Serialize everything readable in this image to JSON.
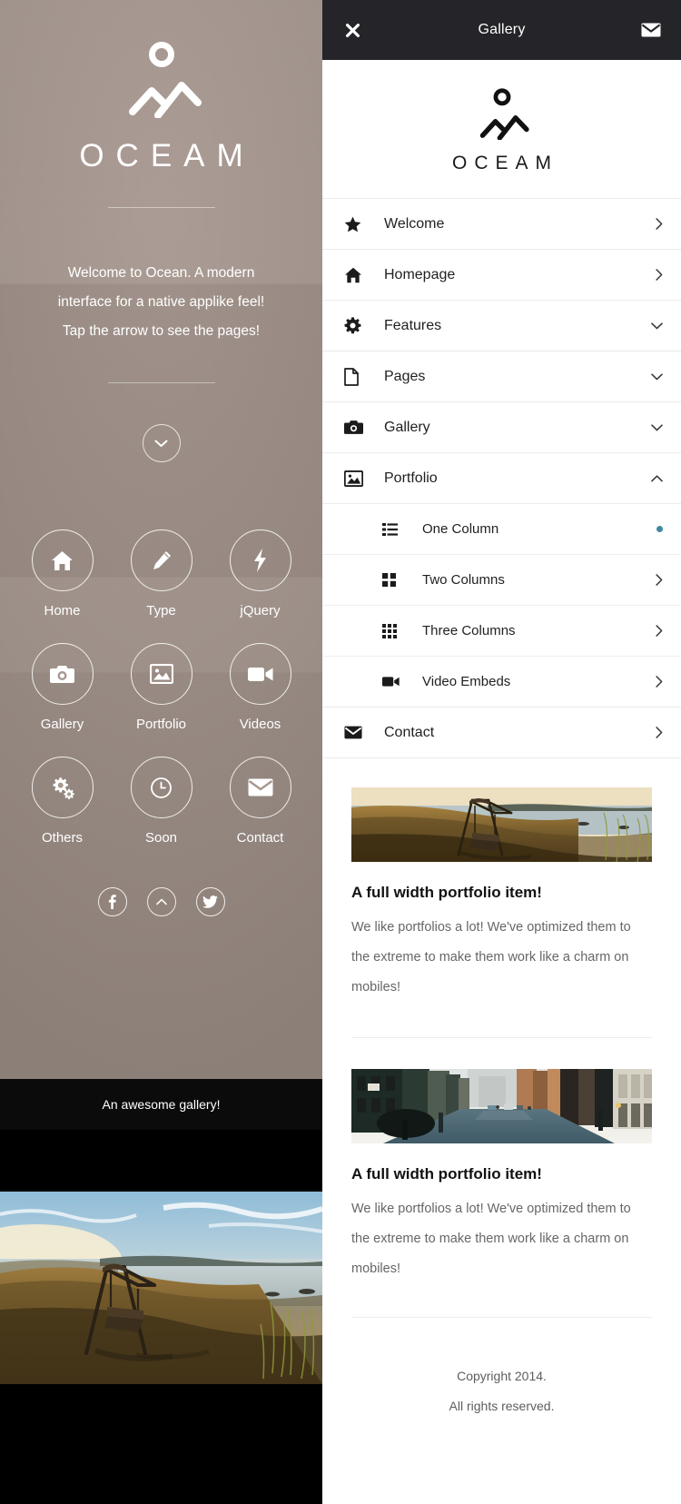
{
  "left": {
    "brand": "OCEAM",
    "logo_icon": "mountain-sun-logo",
    "hero_lines": [
      "Welcome to Ocean. A modern",
      "interface for a native applike feel!",
      "Tap the arrow to see the pages!"
    ],
    "scroll_icon": "chevron-down-icon",
    "grid": [
      {
        "label": "Home",
        "icon": "home-icon"
      },
      {
        "label": "Type",
        "icon": "pencil-icon"
      },
      {
        "label": "jQuery",
        "icon": "bolt-icon"
      },
      {
        "label": "Gallery",
        "icon": "camera-icon"
      },
      {
        "label": "Portfolio",
        "icon": "image-icon"
      },
      {
        "label": "Videos",
        "icon": "video-camera-icon"
      },
      {
        "label": "Others",
        "icon": "gears-icon"
      },
      {
        "label": "Soon",
        "icon": "clock-icon"
      },
      {
        "label": "Contact",
        "icon": "envelope-icon"
      }
    ],
    "social": [
      {
        "icon": "facebook-icon",
        "glyph": "f"
      },
      {
        "icon": "chevron-up-icon",
        "glyph": "^"
      },
      {
        "icon": "twitter-icon",
        "glyph": "t"
      }
    ],
    "gallery_caption": "An awesome gallery!",
    "photo_alt": "sunset-swing-landscape"
  },
  "right": {
    "topbar": {
      "close_icon": "close-icon",
      "title": "Gallery",
      "mail_icon": "envelope-icon"
    },
    "brand": "OCEAM",
    "logo_icon": "mountain-sun-logo",
    "menu": [
      {
        "label": "Welcome",
        "icon": "star-icon",
        "arrow": "chevron-right"
      },
      {
        "label": "Homepage",
        "icon": "home-icon",
        "arrow": "chevron-right"
      },
      {
        "label": "Features",
        "icon": "gear-icon",
        "arrow": "chevron-down"
      },
      {
        "label": "Pages",
        "icon": "file-icon",
        "arrow": "chevron-down"
      },
      {
        "label": "Gallery",
        "icon": "camera-icon",
        "arrow": "chevron-down"
      },
      {
        "label": "Portfolio",
        "icon": "image-icon",
        "arrow": "chevron-up",
        "expanded": true
      }
    ],
    "submenu": [
      {
        "label": "One Column",
        "icon": "list-icon",
        "state": "active"
      },
      {
        "label": "Two Columns",
        "icon": "grid-2-icon",
        "arrow": "chevron-right"
      },
      {
        "label": "Three Columns",
        "icon": "grid-3-icon",
        "arrow": "chevron-right"
      },
      {
        "label": "Video Embeds",
        "icon": "video-camera-icon",
        "arrow": "chevron-right"
      }
    ],
    "menu_tail": [
      {
        "label": "Contact",
        "icon": "envelope-icon",
        "arrow": "chevron-right"
      }
    ],
    "active_dot_color": "#3d8ba0",
    "portfolio": [
      {
        "image_alt": "sunset-swing-landscape",
        "title": "A full width portfolio item!",
        "text": "We like portfolios a lot! We've optimized them to the extreme to make them work like a charm on mobiles!"
      },
      {
        "image_alt": "urban-street-scene",
        "title": "A full width portfolio item!",
        "text": "We like portfolios a lot! We've optimized them to the extreme to make them work like a charm on mobiles!"
      }
    ],
    "footer": {
      "line1": "Copyright 2014.",
      "line2": "All rights reserved."
    }
  },
  "colors": {
    "topbar_bg": "#242429",
    "panel_bg": "#9b8d85",
    "accent": "#3d8ba0",
    "black_band": "#0b0b0b"
  }
}
